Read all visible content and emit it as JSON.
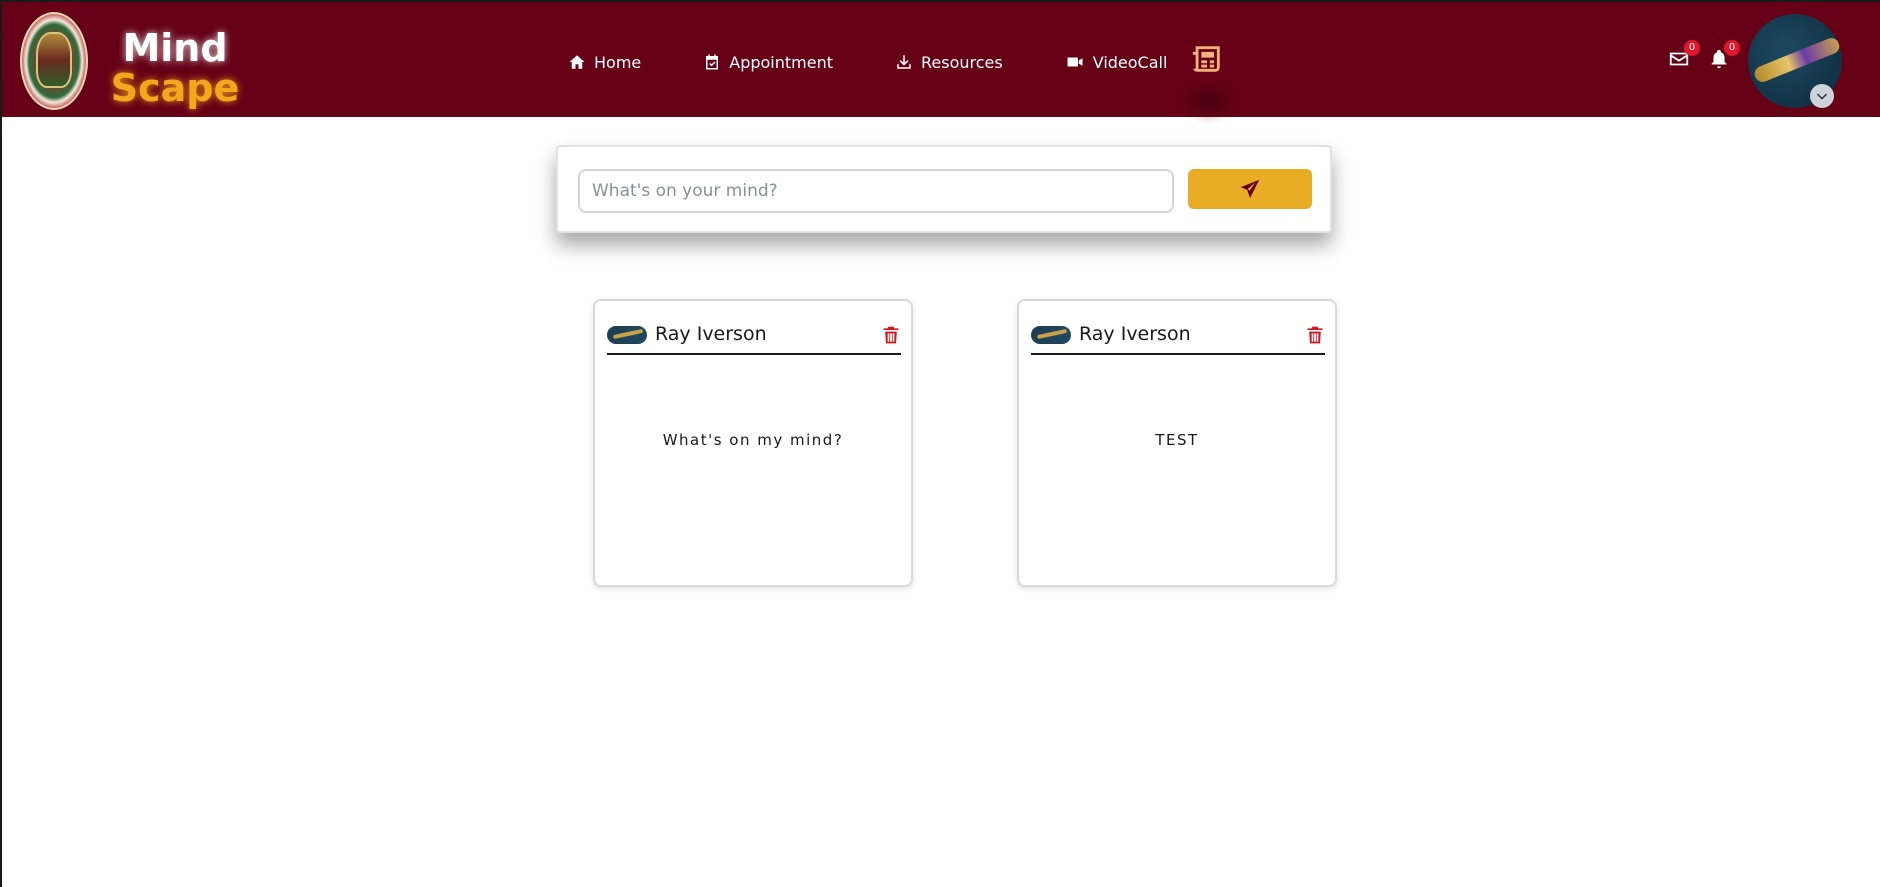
{
  "brand": {
    "line1": "Mind",
    "line2": "Scape"
  },
  "nav": {
    "items": [
      {
        "label": "Home",
        "icon": "home-icon"
      },
      {
        "label": "Appointment",
        "icon": "calendar-icon"
      },
      {
        "label": "Resources",
        "icon": "download-icon"
      },
      {
        "label": "VideoCall",
        "icon": "video-icon"
      }
    ],
    "news_icon": "newspaper-icon"
  },
  "header": {
    "messages_badge": "0",
    "notifications_badge": "0"
  },
  "composer": {
    "placeholder": "What's on your mind?",
    "send_icon": "paper-plane-icon"
  },
  "posts": [
    {
      "author": "Ray Iverson",
      "content": "What's on my mind?"
    },
    {
      "author": "Ray Iverson",
      "content": "TEST"
    }
  ],
  "colors": {
    "navbar": "#650016",
    "accent": "#e8ad24",
    "brand_yellow": "#f3a81b",
    "delete_red": "#d0171e",
    "badge_red": "#e0162a"
  }
}
